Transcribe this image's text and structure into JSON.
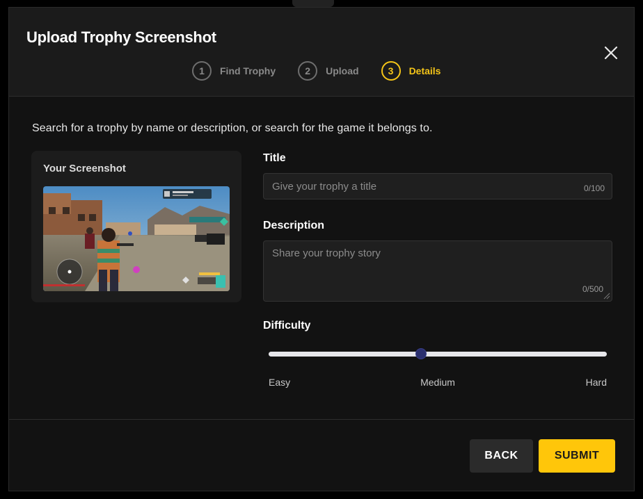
{
  "dialog": {
    "title": "Upload Trophy Screenshot",
    "close_icon": "close-icon"
  },
  "steps": [
    {
      "number": "1",
      "label": "Find Trophy",
      "active": false
    },
    {
      "number": "2",
      "label": "Upload",
      "active": false
    },
    {
      "number": "3",
      "label": "Details",
      "active": true
    }
  ],
  "instructions": "Search for a trophy by name or description, or search for the game it belongs to.",
  "screenshot_card": {
    "title": "Your Screenshot",
    "image_icon": "game-screenshot-image"
  },
  "form": {
    "title": {
      "label": "Title",
      "placeholder": "Give your trophy a title",
      "counter": "0/100"
    },
    "description": {
      "label": "Description",
      "placeholder": "Share your trophy story",
      "counter": "0/500"
    },
    "difficulty": {
      "label": "Difficulty",
      "value_fraction": 0.45,
      "labels": [
        "Easy",
        "Medium",
        "Hard"
      ]
    }
  },
  "footer": {
    "back_label": "BACK",
    "submit_label": "SUBMIT"
  },
  "colors": {
    "accent": "#ffc60a",
    "step_active": "#f5c518",
    "background": "#121212",
    "slider_thumb": "#2a2f6e"
  }
}
